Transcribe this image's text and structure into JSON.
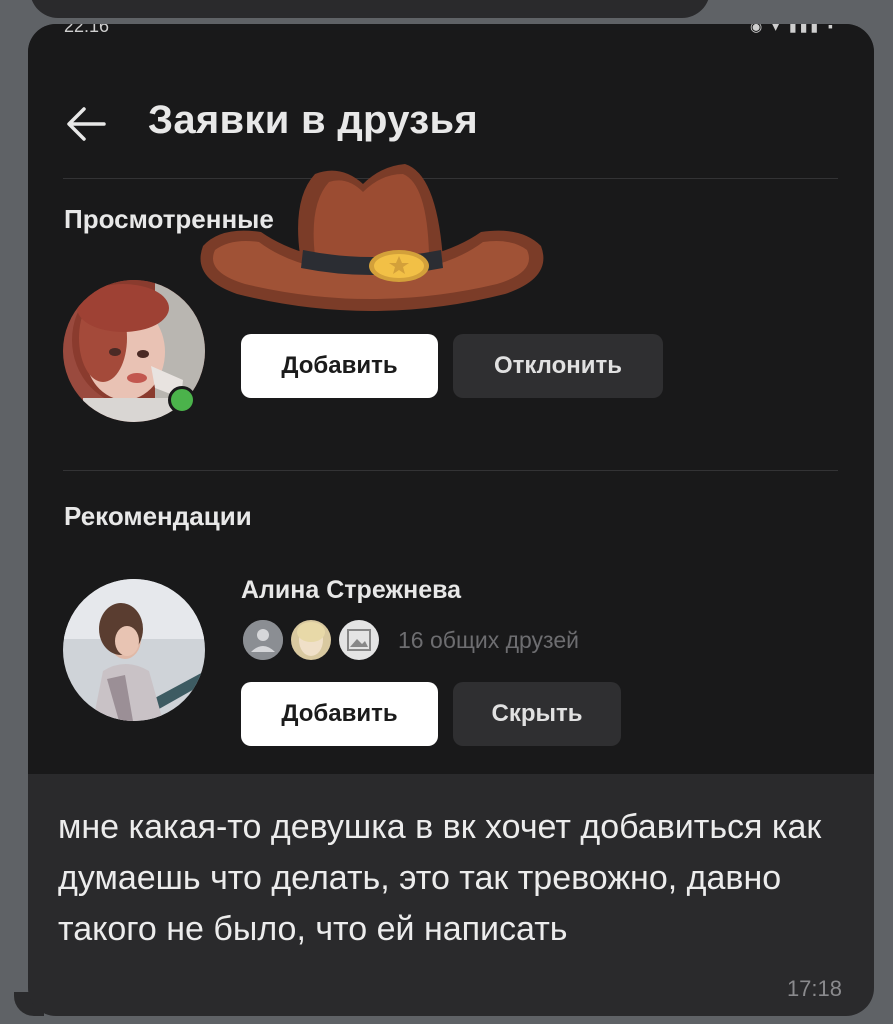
{
  "screen": {
    "title": "Заявки в друзья",
    "status_time": "22:16"
  },
  "viewed_section": {
    "title": "Просмотренные",
    "request": {
      "add_label": "Добавить",
      "decline_label": "Отклонить"
    }
  },
  "recommendations": {
    "title": "Рекомендации",
    "person": {
      "name": "Алина Стрежнева",
      "mutual_friends": "16 общих друзей",
      "add_label": "Добавить",
      "hide_label": "Скрыть"
    }
  },
  "message": {
    "text": "мне какая-то девушка в вк хочет добавиться как думаешь что делать, это так тревожно, давно такого не было, что ей написать",
    "time": "17:18"
  },
  "icons": {
    "back": "arrow-left-icon",
    "sticker": "cowboy-hat-icon",
    "online": "online-dot-icon"
  },
  "colors": {
    "background": "#5f6266",
    "bubble": "#2a2a2c",
    "screen": "#19191a",
    "primary_button": "#ffffff",
    "secondary_button": "#2f2f31",
    "online": "#4bb34b"
  }
}
